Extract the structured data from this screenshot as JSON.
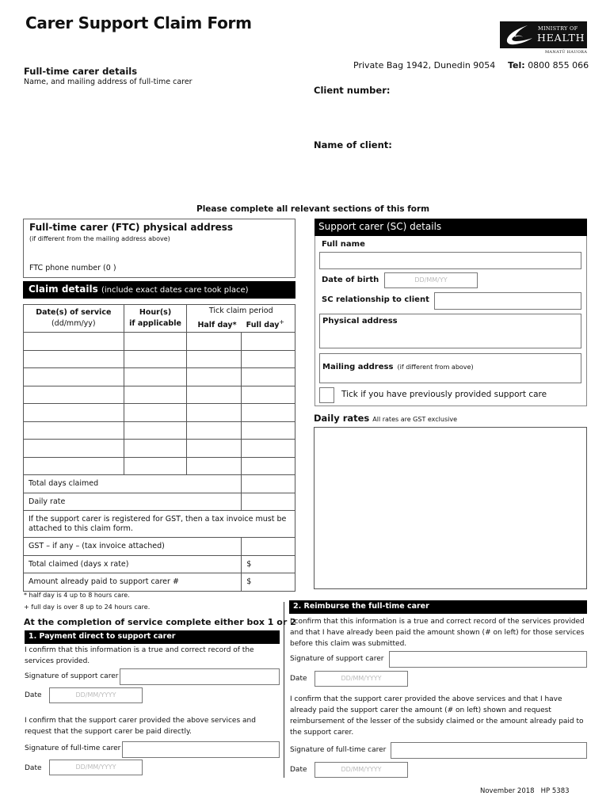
{
  "header": {
    "title": "Carer Support Claim Form",
    "logo": {
      "line1": "MINISTRY OF",
      "line2": "HEALTH",
      "sub": "MANATŪ HAUORA"
    },
    "address": "Private Bag 1942, Dunedin 9054",
    "tel_label": "Tel:",
    "tel_value": "0800 855 066"
  },
  "ftc_details": {
    "heading": "Full-time carer details",
    "subheading": "Name, and mailing address of full-time carer"
  },
  "client": {
    "number_label": "Client number:",
    "name_label": "Name of client:"
  },
  "instruction": "Please complete all relevant sections of this form",
  "ftc_physical": {
    "title": "Full-time carer (FTC) physical address",
    "subtitle": "(if different from the mailing address above)",
    "phone_label": "FTC phone number (0   )"
  },
  "claim": {
    "bar_title": "Claim details",
    "bar_note": "(include exact dates care took place)",
    "headers": {
      "date_line1": "Date(s) of service",
      "date_line2": "(dd/mm/yy)",
      "hours_line1": "Hour(s)",
      "hours_line2": "if applicable",
      "tick_label": "Tick claim period",
      "half_day": "Half day*",
      "full_day": "Full day",
      "full_day_mark": "+"
    },
    "row_count": 8,
    "totals": {
      "total_days": "Total days claimed",
      "daily_rate": "Daily rate",
      "gst_note": "If the support carer is registered for GST, then a tax invoice must be attached to this claim form.",
      "gst": "GST – if any – (tax invoice attached)",
      "total_claimed": "Total claimed (days x rate)",
      "total_claimed_currency": "$",
      "already_paid": "Amount already paid to support carer #",
      "already_paid_currency": "$"
    },
    "footnote1": "* half day is 4 up to 8 hours care.",
    "footnote2": "+ full day is over 8 up to 24 hours care."
  },
  "support_carer": {
    "bar_title": "Support carer (SC) details",
    "full_name_label": "Full name",
    "dob_label": "Date of birth",
    "dob_placeholder": "DD/MM/YY",
    "relationship_label": "SC relationship to client",
    "physical_address_label": "Physical address",
    "mailing_address_label": "Mailing address",
    "mailing_address_note": "(if different from above)",
    "previous_care_label": "Tick if you have previously provided support care"
  },
  "daily_rates": {
    "heading": "Daily rates",
    "note": "All rates are GST exclusive"
  },
  "completion": {
    "heading_pre": "At the completion of service complete either box 1 ",
    "heading_or": "or",
    "heading_post": " 2"
  },
  "box1": {
    "title": "1. Payment direct to support carer",
    "confirm1": "I confirm that this information is a true and correct record of the services provided.",
    "sig_sc_label": "Signature of support carer",
    "date_label": "Date",
    "date_placeholder": "DD/MM/YYYY",
    "confirm2": "I confirm that the support carer provided the above services and request that the support carer be paid directly.",
    "sig_ftc_label": "Signature of full-time carer",
    "date2_label": "Date",
    "date2_placeholder": "DD/MM/YYYY"
  },
  "box2": {
    "title": "2. Reimburse the full-time carer",
    "confirm1": "I confirm that this information is a true and correct record of the services provided and that I have already been paid the amount shown (# on left) for those services before this claim was submitted.",
    "sig_sc_label": "Signature of support carer",
    "date_label": "Date",
    "date_placeholder": "DD/MM/YYYY",
    "confirm2": "I confirm that the support carer provided the above services and that I have already paid the support carer the amount (# on left) shown and request reimbursement of the lesser of the subsidy claimed or the amount already paid to the support carer.",
    "sig_ftc_label": "Signature of full-time carer",
    "date2_label": "Date",
    "date2_placeholder": "DD/MM/YYYY"
  },
  "footer": "November 2018   HP 5383"
}
